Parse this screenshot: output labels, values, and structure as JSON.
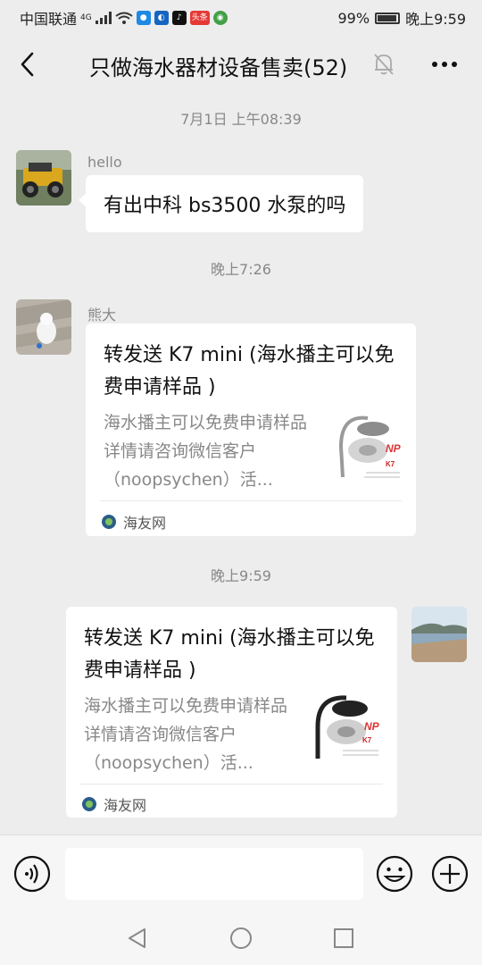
{
  "status": {
    "carrier": "中国联通",
    "network": "4G",
    "battery": "99%",
    "time": "晚上9:59",
    "app_icon_label": "头条"
  },
  "header": {
    "back_icon": "chevron-left-icon",
    "title": "只做海水器材设备售卖(52)",
    "mute_icon": "bell-muted-icon",
    "more_icon": "more-dots-icon"
  },
  "messages": [
    {
      "time": "7月1日 上午08:39"
    },
    {
      "sender": "hello",
      "text": "有出中科 bs3500 水泵的吗"
    },
    {
      "time": "晚上7:26"
    },
    {
      "sender": "熊大",
      "card": {
        "title": "转发送 K7 mini (海水播主可以免费申请样品 )",
        "desc": "海水播主可以免费申请样品详情请咨询微信客户（noopsychen）活...",
        "source": "海友网",
        "thumb_brand": "NP",
        "thumb_model": "K7"
      }
    },
    {
      "time": "晚上9:59"
    },
    {
      "card": {
        "title": "转发送 K7 mini (海水播主可以免费申请样品 )",
        "desc": "海水播主可以免费申请样品详情请咨询微信客户（noopsychen）活...",
        "source": "海友网",
        "thumb_brand": "NP",
        "thumb_model": "K7"
      }
    }
  ],
  "input": {
    "voice_icon": "voice-icon",
    "value": "",
    "emoji_icon": "emoji-icon",
    "plus_icon": "plus-icon"
  },
  "system_nav": {
    "back_icon": "triangle-back-icon",
    "home_icon": "circle-home-icon",
    "recents_icon": "square-recents-icon"
  },
  "colors": {
    "background": "#ededed",
    "bubble": "#ffffff",
    "muted_text": "#888888",
    "status_tiktok": "#111111",
    "status_shield": "#1e88e5",
    "status_toutiao": "#e53935"
  }
}
